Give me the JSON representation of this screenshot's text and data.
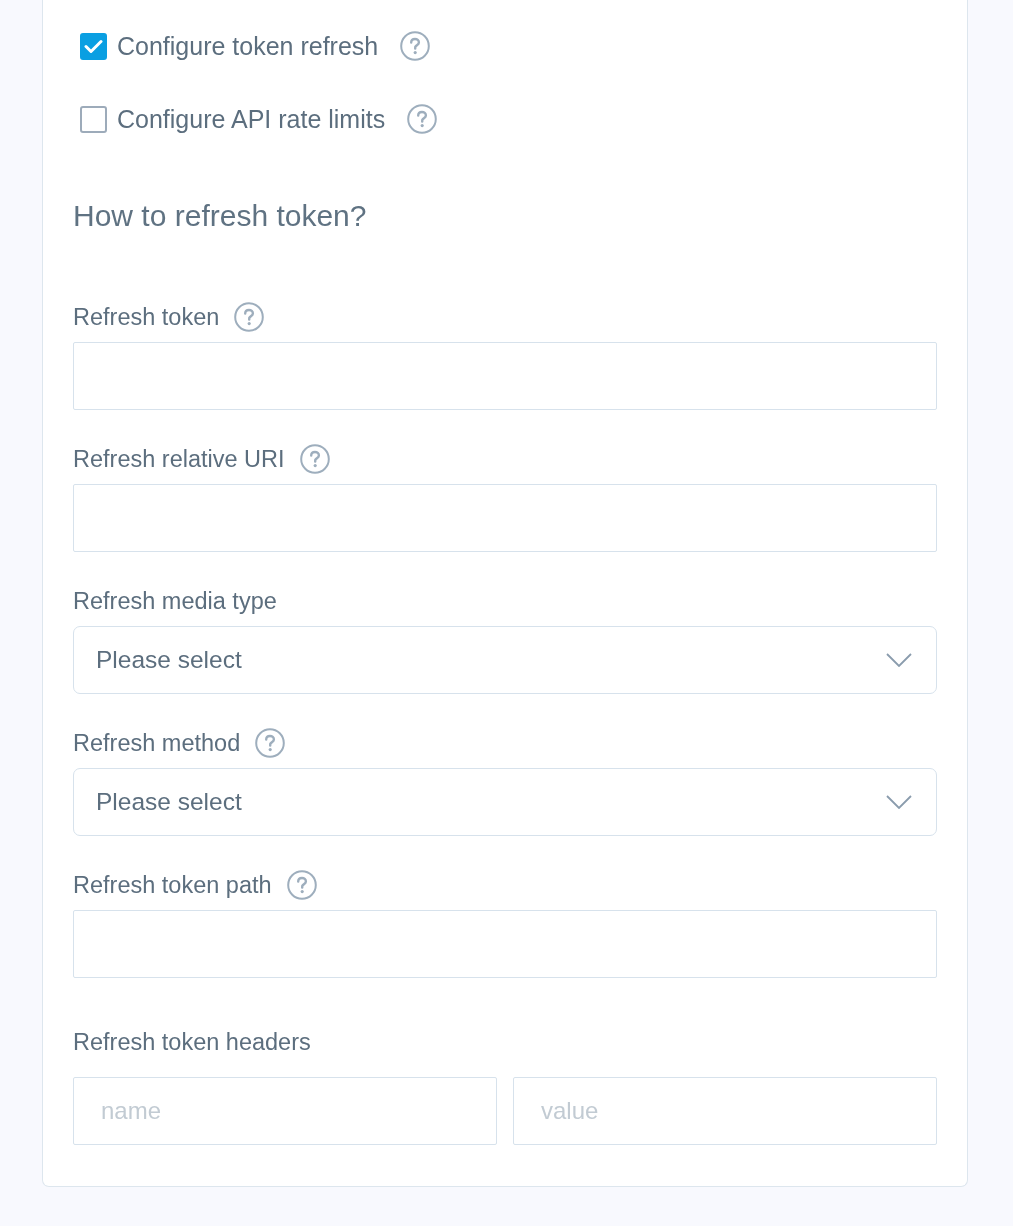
{
  "options": [
    {
      "label": "Configure token refresh",
      "checked": true,
      "help": true
    },
    {
      "label": "Configure API rate limits",
      "checked": false,
      "help": true
    }
  ],
  "section": {
    "title": "How to refresh token?"
  },
  "fields": [
    {
      "kind": "text",
      "label": "Refresh token",
      "help": true
    },
    {
      "kind": "text",
      "label": "Refresh relative URI",
      "help": true
    },
    {
      "kind": "select",
      "label": "Refresh media type",
      "help": false,
      "value": "Please select"
    },
    {
      "kind": "select",
      "label": "Refresh method",
      "help": true,
      "value": "Please select"
    },
    {
      "kind": "text",
      "label": "Refresh token path",
      "help": true
    },
    {
      "kind": "pair",
      "label": "Refresh token headers",
      "help": false,
      "inputs": [
        {
          "placeholder": "name"
        },
        {
          "placeholder": "value"
        }
      ]
    }
  ]
}
